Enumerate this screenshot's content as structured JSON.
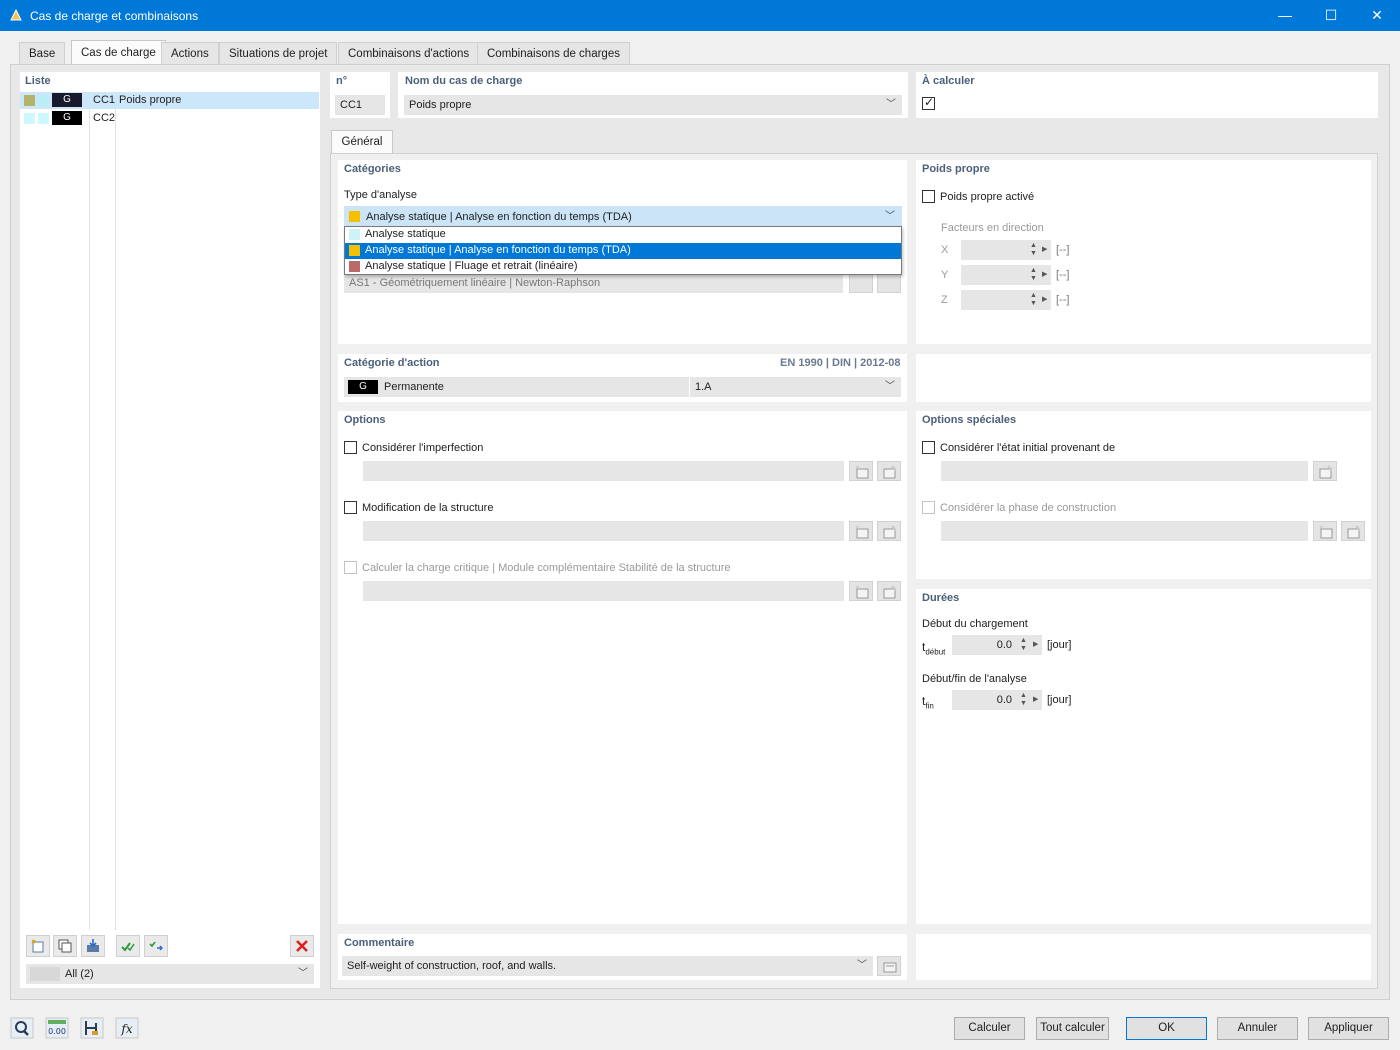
{
  "window": {
    "title": "Cas de charge et combinaisons",
    "minimize": "—",
    "maximize": "☐",
    "close": "✕"
  },
  "tabs": [
    "Base",
    "Cas de charge",
    "Actions",
    "Situations de projet",
    "Combinaisons d'actions",
    "Combinaisons de charges"
  ],
  "list": {
    "title": "Liste",
    "items": [
      {
        "tag": "G",
        "id": "CC1",
        "name": "Poids propre",
        "selected": true
      },
      {
        "tag": "G",
        "id": "CC2",
        "name": "",
        "selected": false
      }
    ],
    "filter": "All (2)"
  },
  "header": {
    "no_label": "n°",
    "no_value": "CC1",
    "name_label": "Nom du cas de charge",
    "name_value": "Poids propre",
    "calc_label": "À calculer",
    "calc_checked": true
  },
  "subtab": "Général",
  "categories": {
    "title": "Catégories",
    "analysis_type_label": "Type d'analyse",
    "analysis_type_value": "Analyse statique | Analyse en fonction du temps (TDA)",
    "dropdown_options": [
      {
        "label": "Analyse statique",
        "color": "#cdf2f8"
      },
      {
        "label": "Analyse statique | Analyse en fonction du temps (TDA)",
        "color": "#f5c000",
        "selected": true
      },
      {
        "label": "Analyse statique | Fluage et retrait (linéaire)",
        "color": "#b96a6a"
      }
    ],
    "hidden_row_text": "AS1 - Géométriquement linéaire | Newton-Raphson"
  },
  "self_weight": {
    "title": "Poids propre",
    "active_label": "Poids propre activé",
    "factors_label": "Facteurs en direction",
    "axes": [
      "X",
      "Y",
      "Z"
    ],
    "unit": "[--]"
  },
  "action_category": {
    "title": "Catégorie d'action",
    "norm": "EN 1990 | DIN | 2012-08",
    "tag": "G",
    "value": "Permanente",
    "code": "1.A"
  },
  "options": {
    "title": "Options",
    "imperfection": "Considérer l'imperfection",
    "structure_mod": "Modification de la structure",
    "critical_load": "Calculer la charge critique | Module complémentaire Stabilité de la structure"
  },
  "special_options": {
    "title": "Options spéciales",
    "initial_state": "Considérer l'état initial provenant de",
    "construction_phase": "Considérer la phase de construction"
  },
  "durations": {
    "title": "Durées",
    "start_label": "Début du chargement",
    "start_sym": "t",
    "start_sub": "début",
    "start_value": "0.0",
    "start_unit": "[jour]",
    "end_label": "Début/fin de l'analyse",
    "end_sym": "t",
    "end_sub": "fin",
    "end_value": "0.0",
    "end_unit": "[jour]"
  },
  "comment": {
    "title": "Commentaire",
    "value": "Self-weight of construction, roof, and walls."
  },
  "buttons": {
    "calc": "Calculer",
    "calc_all": "Tout calculer",
    "ok": "OK",
    "cancel": "Annuler",
    "apply": "Appliquer"
  },
  "bottom_icons": [
    "search-icon",
    "numbers-icon",
    "model-icon",
    "formula-icon"
  ],
  "bottom_icon_text": {
    "numbers": "0.00",
    "formula": "fx"
  }
}
